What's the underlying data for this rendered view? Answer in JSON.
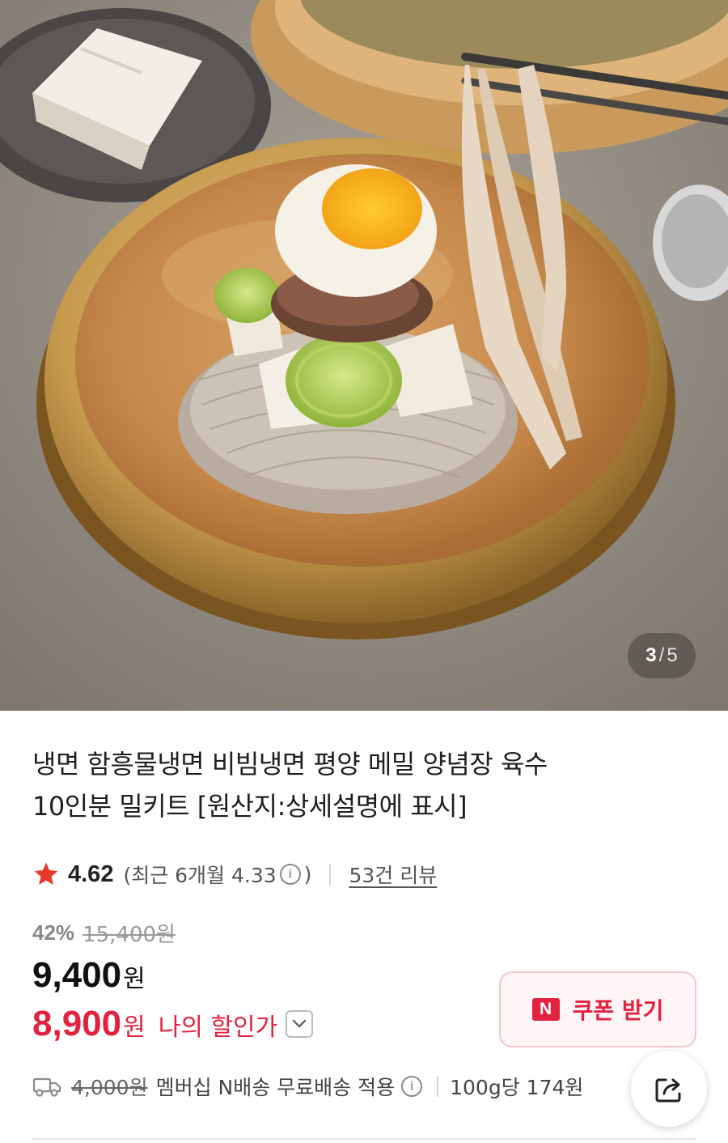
{
  "gallery": {
    "current": "3",
    "separator": "/",
    "total": "5"
  },
  "product": {
    "title_line1": "냉면 함흥물냉면 비빔냉면 평양 메밀 양념장 육수",
    "title_line2": "10인분 밀키트 [원산지:상세설명에 표시]"
  },
  "rating": {
    "score": "4.62",
    "recent_prefix": "(최근 6개월 4.33",
    "recent_suffix": ")",
    "reviews": "53건 리뷰"
  },
  "price": {
    "discount_rate": "42%",
    "original": "15,400원",
    "sale_number": "9,400",
    "sale_unit": "원",
    "my_number": "8,900",
    "my_unit": "원",
    "my_label": "나의 할인가"
  },
  "coupon": {
    "badge": "N",
    "label": "쿠폰 받기"
  },
  "shipping": {
    "original_fee": "4,000원",
    "description": "멤버십 N배송 무료배송 적용",
    "unit_price": "100g당 174원"
  },
  "colors": {
    "accent": "#e2223f",
    "star": "#e8362c"
  }
}
